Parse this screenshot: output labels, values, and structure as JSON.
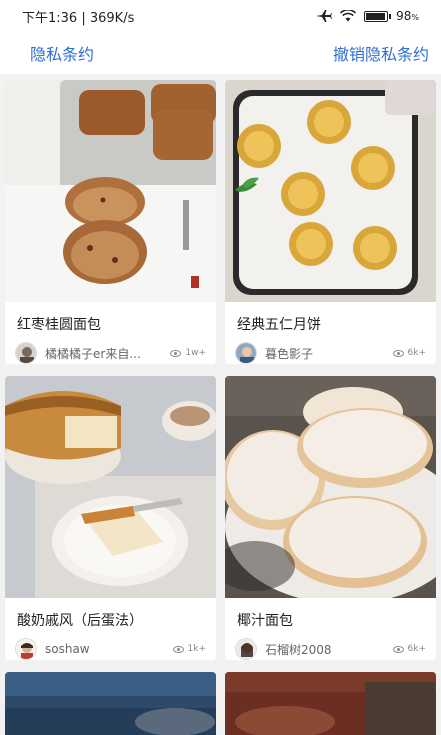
{
  "status": {
    "time": "下午1:36",
    "speed": "369K/s",
    "battery": "98",
    "battery_fill": 0.98
  },
  "header": {
    "privacy": "隐私条约",
    "revoke": "撤销隐私条约"
  },
  "cards": [
    {
      "title": "红枣桂圆面包",
      "author": "橘橘橘子er来自...",
      "views": "1w+"
    },
    {
      "title": "经典五仁月饼",
      "author": "暮色影子",
      "views": "6k+"
    },
    {
      "title": "酸奶戚风（后蛋法）",
      "author": "soshaw",
      "views": "1k+"
    },
    {
      "title": "椰汁面包",
      "author": "石榴树2008",
      "views": "6k+"
    }
  ]
}
